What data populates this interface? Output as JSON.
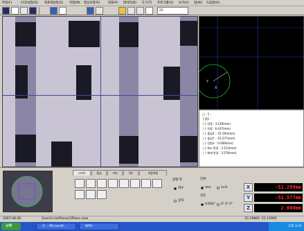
{
  "menubar": {
    "items": [
      "파일(F)",
      "CCD설정(D)",
      "좌표계설정(S)",
      "측정(M)",
      "형상보정(R)",
      "좌표(P)",
      "데이터(B)",
      "도구(T)",
      "프로그램(G)",
      "보기(V)",
      "창(W)",
      "도움말(H)"
    ]
  },
  "toolbar": {
    "combo_value": "25"
  },
  "tabs": [
    "그리기",
    "중심",
    "거리",
    "각도",
    "자동측정"
  ],
  "tree": {
    "lines": [
      "□ - 1 :",
      "  ├ 원1 :",
      "  │  ├ 반경 : 3.129(mm)",
      "  │  ├ 직경 : 6.437(mm)",
      "  │  ├ 중심X : -51.593(mm)",
      "  │  ├ 중심Y : -51.577(mm)",
      "  │  ├ 진원도 : 0.009(mm)",
      "  │  ├ 최소 반경 : 3.113(mm)",
      "  │  └ 최대 반경 : 3.279(mm)"
    ]
  },
  "settings": {
    "group_left_label": "방향 축",
    "option_1": "좌우",
    "option_2": "상하",
    "group_right_label": "단위",
    "unit_mm": "mm",
    "unit_inch": "inch",
    "angle_label": "각도",
    "angle_deg": "0.000°",
    "angle_dms": "0° 0' 0\""
  },
  "dro": {
    "x_label": "X",
    "y_label": "Y",
    "z_label": "Z",
    "x_value": "-51.299mm",
    "y_value": "-51.577mm",
    "z_value": "2.000mm"
  },
  "statusbar": {
    "left": "2007-08-28",
    "center": "OverCircle(Plane)/3Plane.ctae",
    "right": "-51.59805 -51.15992"
  },
  "taskbar": {
    "start": "시작",
    "task_1": "Cl. - Microsoft...",
    "task_2": "WPS -",
    "tray_time": "오후 3:41"
  },
  "colors": {
    "background": "#d4d0c8",
    "dro_text": "#ff3030",
    "taskbar": "#2456c8"
  }
}
